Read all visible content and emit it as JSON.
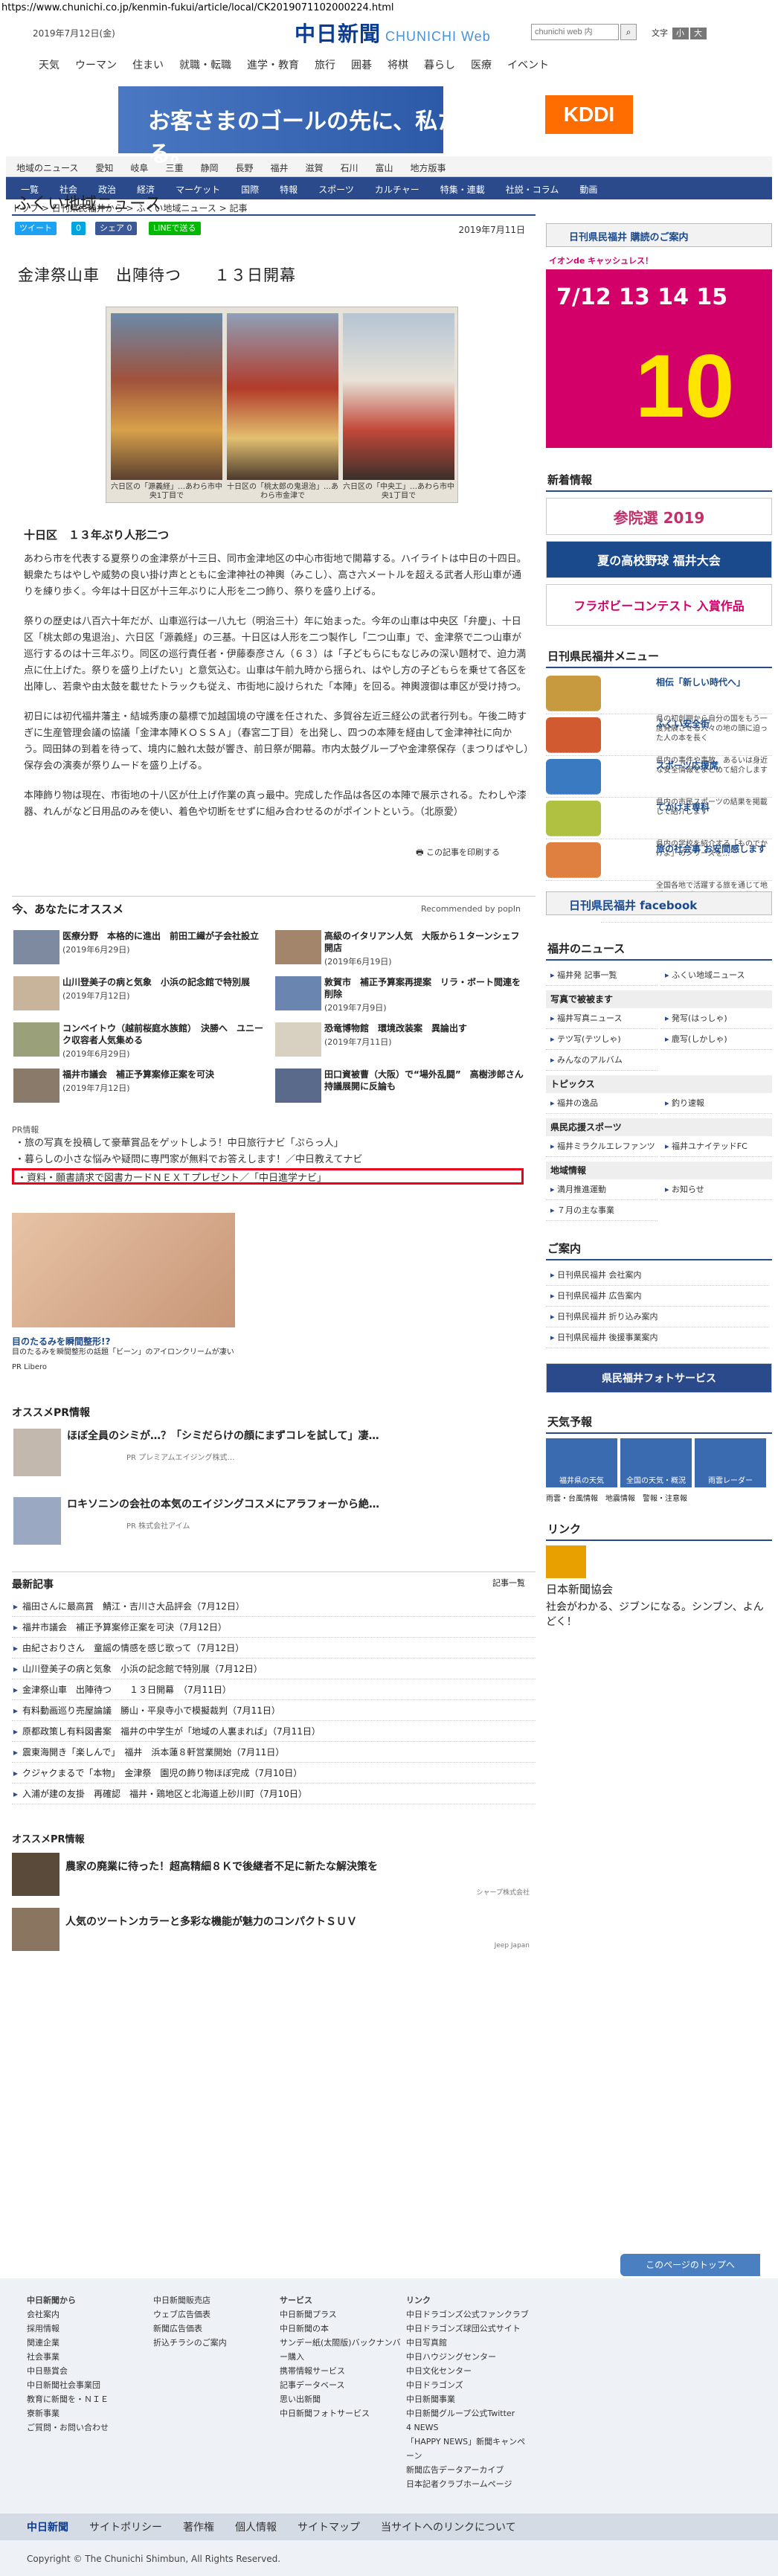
{
  "url": "https://www.chunichi.co.jp/kenmin-fukui/article/local/CK2019071102000224.html",
  "header": {
    "date": "2019年7月12日(金)",
    "logo": "中日新聞",
    "logo_sub": "CHUNICHI Web",
    "search_placeholder": "chunichi web 内",
    "font_label": "文字",
    "font_minus": "小",
    "font_plus": "大"
  },
  "gnav": [
    "天気",
    "ウーマン",
    "住まい",
    "就職・転職",
    "進学・教育",
    "旅行",
    "囲碁",
    "将棋",
    "暮らし",
    "医療",
    "イベント"
  ],
  "ad_top": {
    "text": "お客さまのゴールの先に、私たちのゴールはある。",
    "brand": "KDDI"
  },
  "nav1": [
    "地域のニュース",
    "愛知",
    "岐阜",
    "三重",
    "静岡",
    "長野",
    "福井",
    "滋賀",
    "石川",
    "富山",
    "地方版事"
  ],
  "nav2": [
    "一覧",
    "社会",
    "政治",
    "経済",
    "マーケット",
    "国際",
    "特報",
    "スポーツ",
    "カルチャー",
    "特集・連載",
    "社説・コラム",
    "動画"
  ],
  "breadcrumb": "トップ > 日刊県民福井から > ふくい地域ニュース > 記事",
  "section_title": "ふくい地域ニュース",
  "share": {
    "tweet": "ツイート",
    "b": "0",
    "fb": "シェア 0",
    "line": "LINEで送る",
    "date": "2019年7月11日"
  },
  "article": {
    "title": "金津祭山車　出陣待つ　　１３日開幕",
    "captions": [
      "六日区の「源義経」…あわら市中央1丁目で",
      "十日区の「桃太郎の鬼退治」…あわら市金津で",
      "六日区の「中央工」…あわら市中央1丁目で"
    ],
    "subheading": "十日区　１３年ぶり人形二つ",
    "paragraphs": [
      "あわら市を代表する夏祭りの金津祭が十三日、同市金津地区の中心市街地で開幕する。ハイライトは中日の十四日。観衆たちはやしや威勢の良い掛け声とともに金津神社の神輿（みこし）、高さ六メートルを超える武者人形山車が通りを練り歩く。今年は十日区が十三年ぶりに人形を二つ飾り、祭りを盛り上げる。",
      "祭りの歴史は八百六十年だが、山車巡行は一八九七（明治三十）年に始まった。今年の山車は中央区「弁慶」、十日区「桃太郎の鬼退治」、六日区「源義経」の三基。十日区は人形を二つ製作し「二つ山車」で、金津祭で二つ山車が巡行するのは十三年ぶり。同区の巡行責任者・伊藤泰彦さん（６３）は「子どもらにもなじみの深い題材で、迫力満点に仕上げた。祭りを盛り上げたい」と意気込む。山車は午前九時から揺られ、はやし方の子どもらを乗せて各区を出陣し、若衆や由太鼓を載せたトラックも従え、市街地に設けられた「本陣」を回る。神輿渡御は車区が受け持つ。",
      "初日には初代福井藩主・結城秀康の墓標で加越国境の守護を任された、多賀谷左近三経公の武者行列も。午後二時すぎに生産管理会議の協議「金津本陣ＫＯＳＳＡ」（春宮二丁目）を出発し、四つの本陣を経由して金津神社に向かう。岡田鉢の到着を待って、境内に触れ太鼓が響き、前日祭が開幕。市内太鼓グループや金津祭保存（まつりばやし）保存会の演奏が祭りムードを盛り上げる。",
      "本陣飾り物は現在、市街地の十八区が仕上げ作業の真っ最中。完成した作品は各区の本陣で展示される。たわしや漆器、れんがなど日用品のみを使い、着色や切断をせずに組み合わせるのがポイントという。（北原愛）"
    ],
    "print": "この記事を印刷する"
  },
  "recommend": {
    "title": "今、あなたにオススメ",
    "powered": "Recommended by popIn",
    "items": [
      {
        "t": "医療分野　本格的に進出　前田工繊が子会社設立",
        "d": "(2019年6月29日)"
      },
      {
        "t": "高級のイタリアン人気　大阪から１ターンシェフ開店",
        "d": "(2019年6月19日)"
      },
      {
        "t": "山川登美子の病と気象　小浜の記念館で特別展",
        "d": "(2019年7月12日)"
      },
      {
        "t": "敦賀市　補正予算案再提案　リラ・ボート閲連を削除",
        "d": "(2019年7月9日)"
      },
      {
        "t": "コンベイトウ（越前桜庭水族館）　決勝へ　ユニーク収容者人気集める",
        "d": "(2019年6月29日)"
      },
      {
        "t": "恐竜博物館　環境改装案　異論出す",
        "d": "(2019年7月11日)"
      },
      {
        "t": "福井市議会　補正予算案修正案を可決",
        "d": "(2019年7月12日)"
      },
      {
        "t": "田口資被曹（大阪）で“場外乱闘”　高樹涉郎さん持議展開に反論も",
        "d": ""
      }
    ]
  },
  "pr_label": "PR情報",
  "pr_links": [
    "・旅の写真を投稿して豪華賞品をゲットしよう！中日旅行ナビ「ぷらっ人」",
    "・暮らしの小さな悩みや疑問に専門家が無料でお答えします！／中日教えてナビ",
    "・資料・願書請求で図書カードＮＥＸＴプレゼント／「中日進学ナビ」"
  ],
  "beauty": {
    "title": "目のたるみを瞬間整形!?",
    "desc": "目のたるみを瞬間整形の話題「ビーン」のアイロンクリームが凄い",
    "sponsor": "PR Libero"
  },
  "osusume": {
    "title": "オススメPR情報",
    "items": [
      {
        "t": "ほぼ全員のシミが…？「シミだらけの顔にまずコレを試して」凄…",
        "s": "PR プレミアムエイジング株式…"
      },
      {
        "t": "ロキソニンの会社の本気のエイジングコスメにアラフォーから絶…",
        "s": "PR 株式会社アイム"
      }
    ]
  },
  "latest": {
    "title": "最新記事",
    "all": "記事一覧",
    "items": [
      "福田さんに最高賞　鯖江・吉川さ大品評会（7月12日）",
      "福井市議会　補正予算案修正案を可決（7月12日）",
      "由紀さおりさん　童謡の情感を感じ歌って（7月12日）",
      "山川登美子の病と気象　小浜の記念館で特別展（7月12日）",
      "金津祭山車　出陣待つ　　１３日開幕　（7月11日）",
      "有料動画巡り売屋論議　勝山・平泉寺小で模擬裁判（7月11日）",
      "原都政策し有料図書案　福井の中学生が「地域の人裏まれば」（7月11日）",
      "震東海開き「楽しんで」　福井　浜本蓮８軒営業開始（7月11日）",
      "クジャクまるで「本物」　金津祭　園児の飾り物ほぼ完成（7月10日）",
      "入浦が建の友掛　再確認　福井・鶏地区と北海道上砂川町（7月10日）"
    ]
  },
  "prinfo": {
    "title": "オススメPR情報",
    "items": [
      {
        "t": "農家の廃業に待った！超高精細８Ｋで後継者不足に新たな解決策を",
        "s": "シャープ株式会社"
      },
      {
        "t": "人気のツートンカラーと多彩な機能が魅力のコンパクトＳＵＶ",
        "s": "Jeep Japan"
      }
    ]
  },
  "side": {
    "subscribe": "日刊県民福井 購読のご案内",
    "aeon_top": "イオンde キャッシュレス！",
    "aeon_date": "7/12 13 14 15",
    "aeon_big": "10倍",
    "new_label": "新着情報",
    "sanin": "参院選 2019",
    "koshien": "夏の高校野球 福井大会",
    "hula": "フラボビーコンテスト 入賞作品",
    "menu_title": "日刊県民福井メニュー",
    "menu": [
      {
        "t": "相伝「新しい時代へ」",
        "d": "県の初創期から自分の国をもう一度発展させる人々の地の頭に迫った人の本を長く"
      },
      {
        "t": "ふくい安全街",
        "d": "県内の事件や事故、あるいは身近な安全情報をまとめて紹介します"
      },
      {
        "t": "スポーツ応援席",
        "d": "県内の市民スポーツの結果を掲載して紹介します"
      },
      {
        "t": "てかけま専科",
        "d": "県内の学校を紹介する「ものでかけよ」のシリーズを…"
      },
      {
        "t": "旅の社会事 お安間感します",
        "d": "全国各地で活躍する旅を通じて地域のインプランのヒントを紹介"
      }
    ],
    "fb": "日刊県民福井 facebook",
    "news_title": "福井のニュース",
    "news": [
      "福井発 記事一覧",
      "ふくい地域ニュース"
    ],
    "photo": "写真で被被ます",
    "photo_links": [
      "福井写真ニュース",
      "発写(はっしゃ)",
      "テツ写(テツしゃ)",
      "鹿写(しかしゃ)",
      "みんなのアルバム"
    ],
    "topics": "トピックス",
    "topics_links": [
      "福井の逸品",
      "釣り速報"
    ],
    "sports": "県民応援スポーツ",
    "sports_links": [
      "福井ミラクルエレファンツ",
      "福井ユナイテッドFC"
    ],
    "region": "地域情報",
    "region_links": [
      "満月推進運動",
      "お知らせ",
      "７月の主な事業"
    ],
    "guide": "ご案内",
    "guide_links": [
      "日刊県民福井 会社案内",
      "日刊県民福井 広告案内",
      "日刊県民福井 折り込み案内",
      "日刊県民福井 後援事業案内"
    ],
    "photo_service": "県民福井フォトサービス",
    "weather_title": "天気予報",
    "weather": [
      "福井県の天気",
      "全国の天気・概況",
      "雨雲レーダー"
    ],
    "weather_links": [
      "雨雲・台風情報",
      "地震情報",
      "警報・注意報"
    ],
    "link_title": "リンク",
    "link_name": "日本新聞協会",
    "link_desc": "社会がわかる、ジブンになる。シンブン、よんどく！"
  },
  "footer": {
    "top": "このページのトップへ",
    "cols": [
      [
        "中日新聞から",
        "会社案内",
        "採用情報",
        "関連企業",
        "社会事業",
        "中日懸賞会",
        "中日新聞社会事業団",
        "教育に新聞を・ＮＩＥ",
        "寮新事業",
        "ご質問・お問い合わせ"
      ],
      [
        "",
        "中日新聞販売店",
        "ウェブ広告価表",
        "新聞広告価表",
        "折込チラシのご案内"
      ],
      [
        "サービス",
        "中日新聞プラス",
        "中日新聞の本",
        "サンデー紙(太閤版)バックナンバー購入",
        "携帯情報サービス",
        "記事データベース",
        "思い出新聞",
        "中日新聞フォトサービス"
      ],
      [
        "リンク",
        "中日ドラゴンズ公式ファンクラブ",
        "中日ドラゴンズ球団公式サイト",
        "中日写真館",
        "中日ハウジングセンター",
        "中日文化センター",
        "中日ドラゴンズ",
        "中日新聞事業",
        "中日新聞グループ公式Twitter",
        "4 NEWS",
        "「HAPPY NEWS」新聞キャンペーン",
        "新聞広告データアーカイブ",
        "日本記者クラブホームページ"
      ]
    ],
    "bar": [
      "中日新聞",
      "サイトポリシー",
      "著作権",
      "個人情報",
      "サイトマップ",
      "当サイトへのリンクについて"
    ],
    "copy": "Copyright © The Chunichi Shimbun, All Rights Reserved."
  }
}
